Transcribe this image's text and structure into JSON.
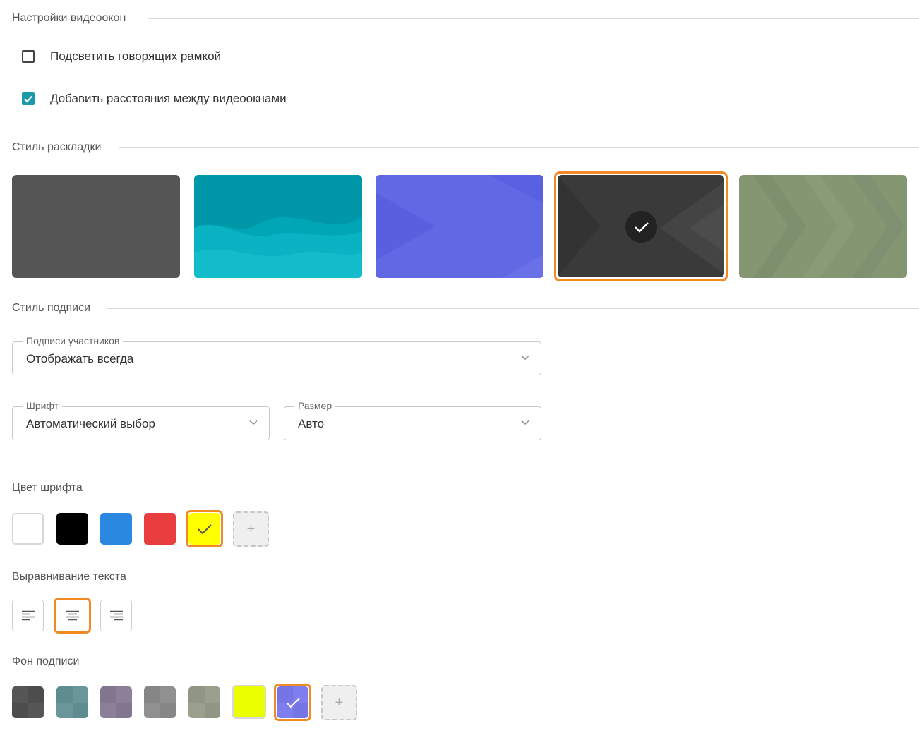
{
  "video_settings": {
    "title": "Настройки видеоокон",
    "options": [
      {
        "label": "Подсветить говорящих рамкой",
        "checked": false
      },
      {
        "label": "Добавить расстояния между видеоокнами",
        "checked": true
      }
    ]
  },
  "layout_style": {
    "title": "Стиль раскладки",
    "tiles": [
      {
        "name": "gray",
        "color": "#555555",
        "selected": false
      },
      {
        "name": "teal-waves",
        "color": "#00aab8",
        "selected": false
      },
      {
        "name": "blue-chevrons",
        "color": "#5f67e3",
        "selected": false
      },
      {
        "name": "dark-chevrons",
        "color": "#3a3a3a",
        "selected": true
      },
      {
        "name": "olive-chevrons",
        "color": "#849672",
        "selected": false
      }
    ],
    "selected_index": 3
  },
  "caption_style": {
    "title": "Стиль подписи",
    "participant_labels": {
      "label": "Подписи участников",
      "value": "Отображать всегда"
    },
    "font": {
      "label": "Шрифт",
      "value": "Автоматический выбор"
    },
    "size": {
      "label": "Размер",
      "value": "Авто"
    }
  },
  "font_color": {
    "title": "Цвет шрифта",
    "colors": [
      "#ffffff",
      "#000000",
      "#2b88e0",
      "#e83e3e",
      "#ffff00"
    ],
    "selected_index": 4,
    "add_label": "+"
  },
  "text_align": {
    "title": "Выравнивание текста",
    "options": [
      "align-left",
      "align-center",
      "align-right"
    ],
    "selected_index": 1
  },
  "caption_bg": {
    "title": "Фон подписи",
    "colors": [
      "#4d4d4d",
      "#6a9699",
      "#8b8098",
      "#909090",
      "#9aa08e",
      "#eaff00",
      "#7f7ef0"
    ],
    "selected_index": 6,
    "add_label": "+"
  },
  "colors": {
    "accent": "#f08a24",
    "checkbox": "#1a9aa8"
  }
}
